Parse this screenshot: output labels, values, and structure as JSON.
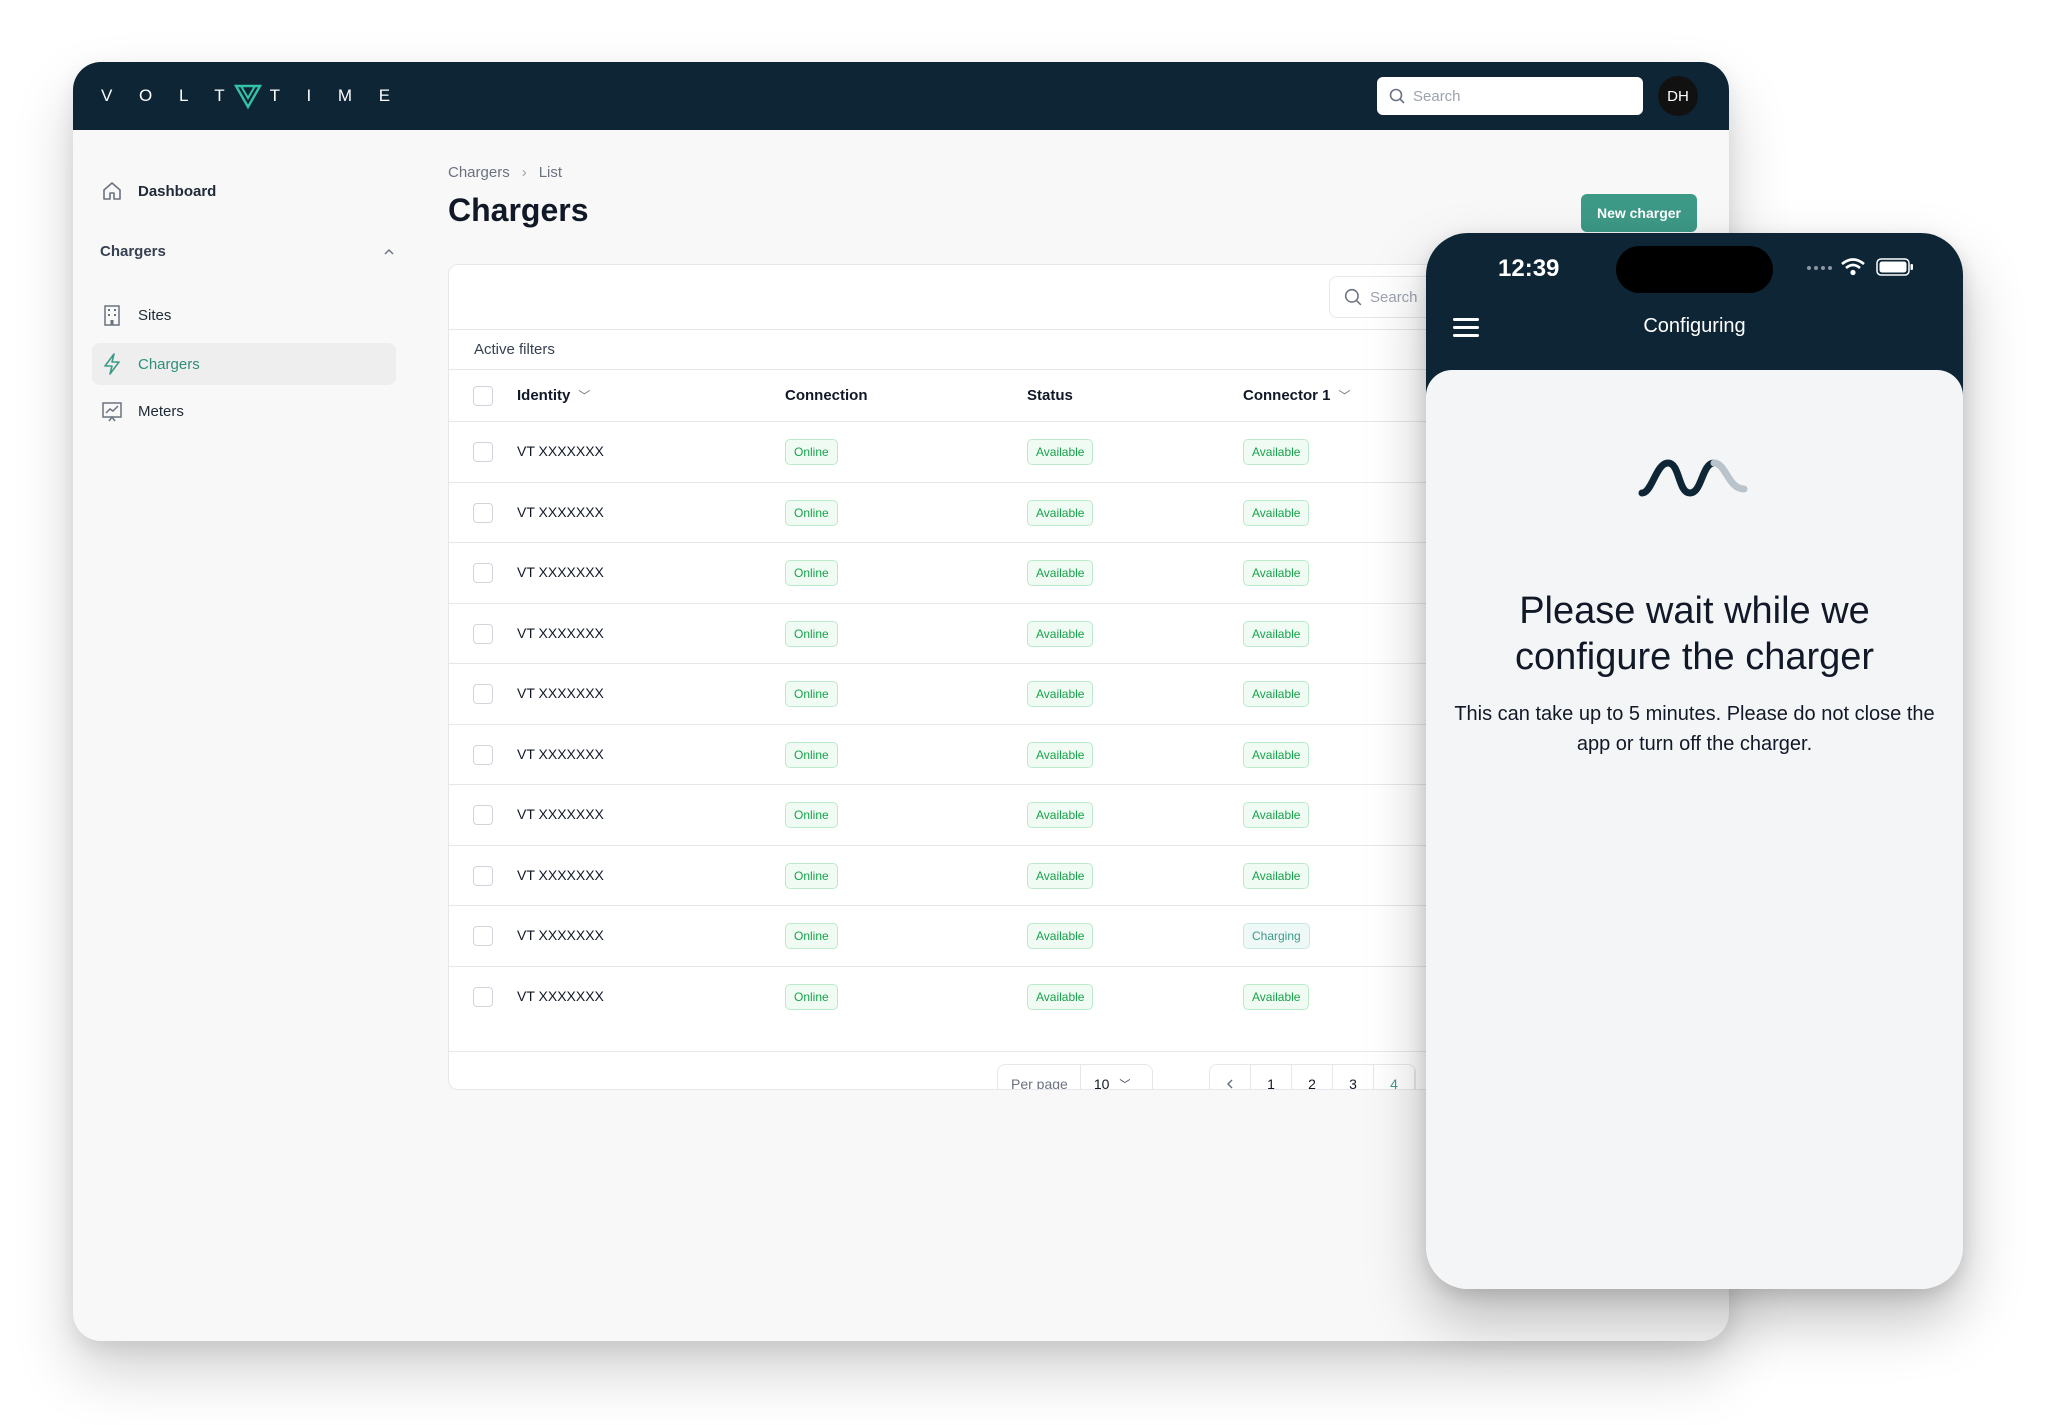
{
  "app": {
    "logo_text": "VOLTTIME",
    "search_placeholder": "Search",
    "avatar_initials": "DH"
  },
  "sidebar": {
    "dashboard_label": "Dashboard",
    "group_label": "Chargers",
    "items": [
      {
        "label": "Sites",
        "icon": "building-icon"
      },
      {
        "label": "Chargers",
        "icon": "bolt-icon",
        "active": true
      },
      {
        "label": "Meters",
        "icon": "chart-icon"
      }
    ]
  },
  "main": {
    "breadcrumb": [
      "Chargers",
      "List"
    ],
    "title": "Chargers",
    "new_button": "New charger",
    "table_search_placeholder": "Search",
    "active_filters_label": "Active filters",
    "columns": [
      "Identity",
      "Connection",
      "Status",
      "Connector 1"
    ],
    "rows": [
      {
        "identity": "VT XXXXXXX",
        "connection": "Online",
        "status": "Available",
        "connector": "Available"
      },
      {
        "identity": "VT XXXXXXX",
        "connection": "Online",
        "status": "Available",
        "connector": "Available"
      },
      {
        "identity": "VT XXXXXXX",
        "connection": "Online",
        "status": "Available",
        "connector": "Available"
      },
      {
        "identity": "VT XXXXXXX",
        "connection": "Online",
        "status": "Available",
        "connector": "Available"
      },
      {
        "identity": "VT XXXXXXX",
        "connection": "Online",
        "status": "Available",
        "connector": "Available"
      },
      {
        "identity": "VT XXXXXXX",
        "connection": "Online",
        "status": "Available",
        "connector": "Available"
      },
      {
        "identity": "VT XXXXXXX",
        "connection": "Online",
        "status": "Available",
        "connector": "Available"
      },
      {
        "identity": "VT XXXXXXX",
        "connection": "Online",
        "status": "Available",
        "connector": "Available"
      },
      {
        "identity": "VT XXXXXXX",
        "connection": "Online",
        "status": "Available",
        "connector": "Charging"
      },
      {
        "identity": "VT XXXXXXX",
        "connection": "Online",
        "status": "Available",
        "connector": "Available"
      }
    ],
    "pagination": {
      "per_page_label": "Per page",
      "per_page_value": "10",
      "pages": [
        "1",
        "2",
        "3",
        "4"
      ],
      "current_page": "4"
    }
  },
  "phone": {
    "time": "12:39",
    "header_title": "Configuring",
    "message_title": "Please wait while we configure the charger",
    "message_body": "This can take up to 5 minutes. Please do not close the app or turn off the charger."
  },
  "colors": {
    "navy": "#0e2536",
    "accent": "#3d9a87",
    "success": "#16a34a"
  }
}
